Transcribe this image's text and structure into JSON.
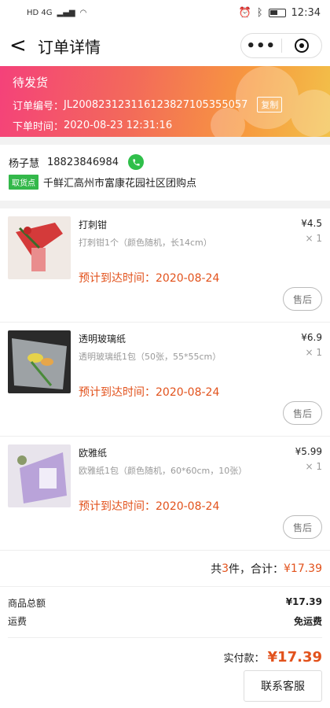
{
  "status_bar": {
    "network": "HD 4G",
    "time": "12:34"
  },
  "nav": {
    "title": "订单详情"
  },
  "banner": {
    "status": "待发货",
    "order_no_label": "订单编号：",
    "order_no": "JL20082312311612382710535505​7",
    "copy_label": "复制",
    "time_label": "下单时间：",
    "time": "2020-08-23 12:31:16"
  },
  "address": {
    "name": "杨子慧",
    "phone": "18823846984",
    "tag": "取货点",
    "location": "千鲜汇高州市富康花园社区团购点"
  },
  "items": [
    {
      "name": "打刺钳",
      "spec": "打刺钳1个（颜色随机，长14cm）",
      "eta": "预计到达时间：2020-08-24",
      "price": "¥4.5",
      "qty": "× 1",
      "after_label": "售后"
    },
    {
      "name": "透明玻璃纸",
      "spec": "透明玻璃纸1包（50张，55*55cm）",
      "eta": "预计到达时间：2020-08-24",
      "price": "¥6.9",
      "qty": "× 1",
      "after_label": "售后"
    },
    {
      "name": "欧雅纸",
      "spec": "欧雅纸1包（颜色随机，60*60cm，10张）",
      "eta": "预计到达时间：2020-08-24",
      "price": "¥5.99",
      "qty": "× 1",
      "after_label": "售后"
    }
  ],
  "total": {
    "prefix": "共 ",
    "count": "3",
    "mid": " 件，合计：",
    "amount": "¥17.39"
  },
  "summary": {
    "goods_label": "商品总额",
    "goods_value": "¥17.39",
    "shipping_label": "运费",
    "shipping_value": "免运费"
  },
  "payment": {
    "label": "实付款：",
    "amount": "¥17.39"
  },
  "contact_label": "联系客服",
  "colors": {
    "accent": "#e2521c",
    "tag_green": "#33b84a"
  }
}
